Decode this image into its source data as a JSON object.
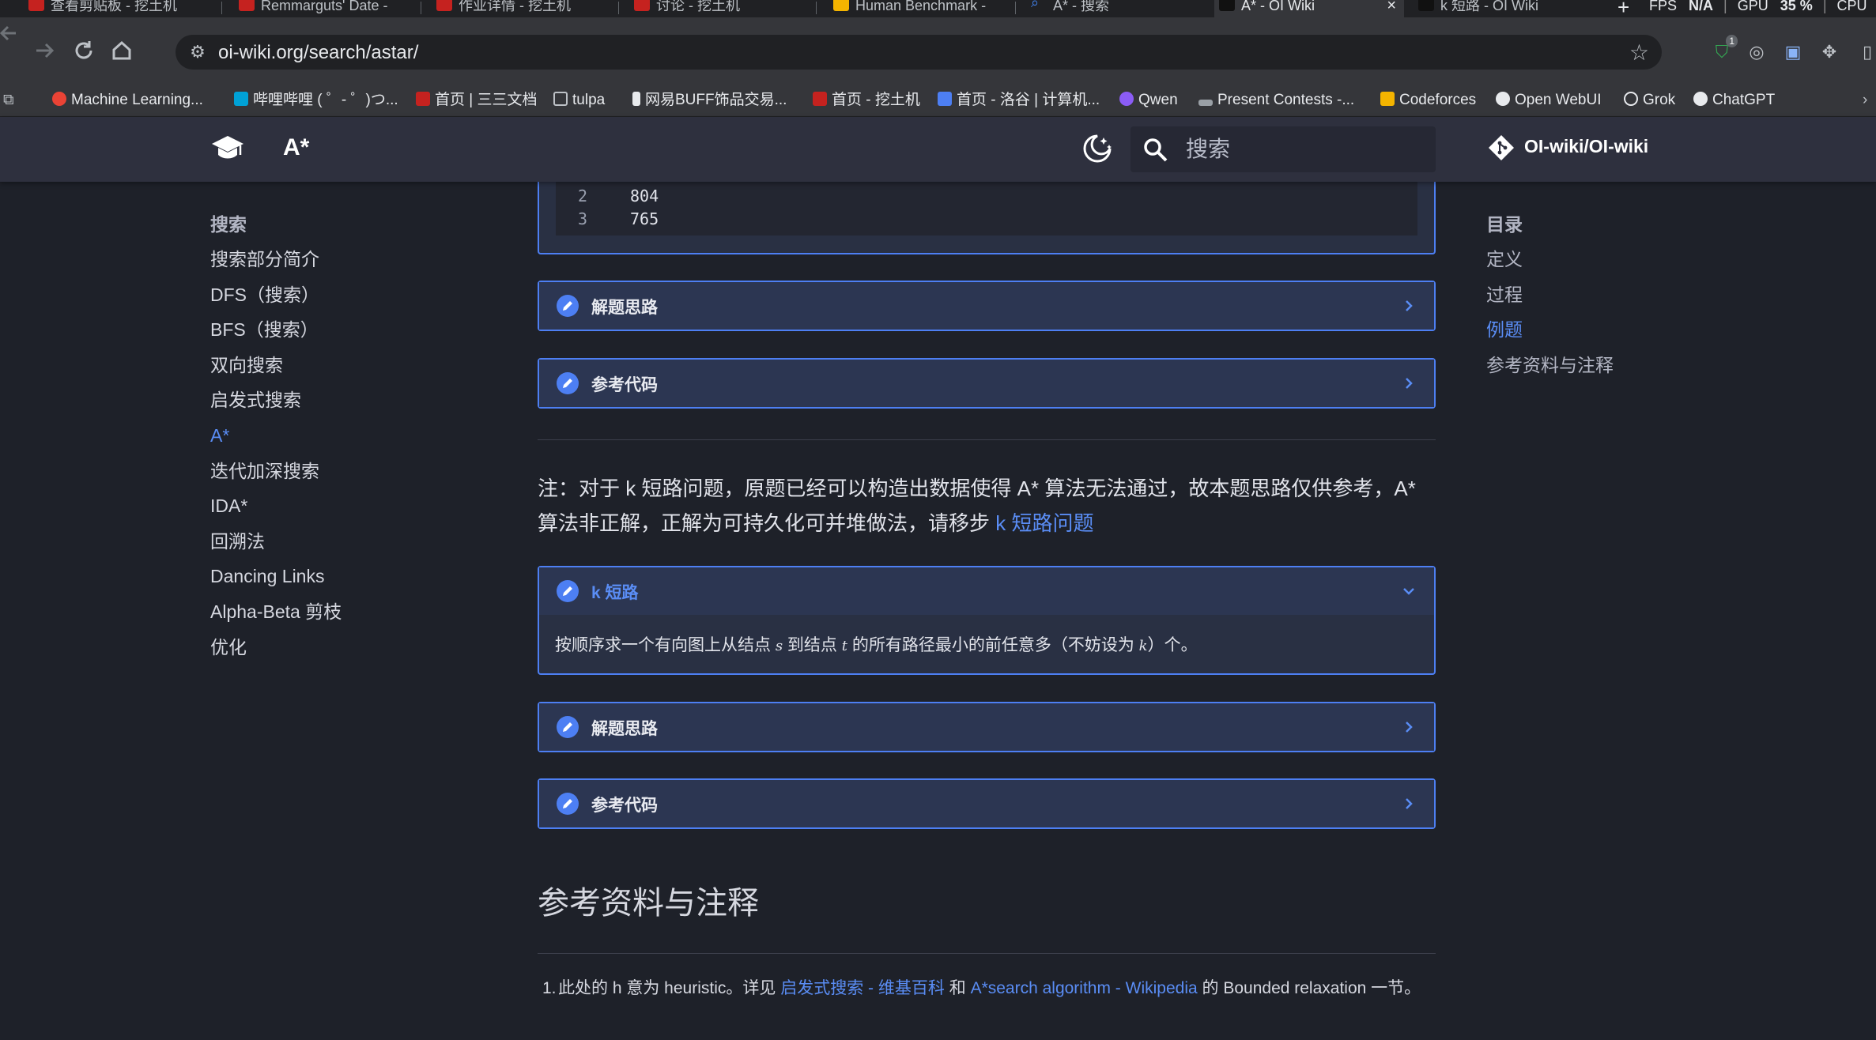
{
  "browser": {
    "tabs": [
      {
        "title": "查看剪贴板 - 挖土机",
        "color": "#c5221f"
      },
      {
        "title": "Remmarguts' Date -",
        "color": "#c5221f"
      },
      {
        "title": "作业详情 - 挖土机",
        "color": "#c5221f"
      },
      {
        "title": "讨论 - 挖土机",
        "color": "#c5221f"
      },
      {
        "title": "Human Benchmark -",
        "color": "#f4b400"
      },
      {
        "title": "A* - 搜索",
        "color": "#4285f4"
      },
      {
        "title": "A* - OI Wiki",
        "color": "#202124"
      },
      {
        "title": "k 短路 - OI Wiki",
        "color": "#202124"
      }
    ],
    "active_tab_close": "×",
    "new_tab": "+",
    "sysinfo": {
      "fps_label": "FPS",
      "fps_value": "N/A",
      "gpu_label": "GPU",
      "gpu_value": "35 %",
      "cpu_label": "CPU"
    },
    "url": "oi-wiki.org/search/astar/",
    "ext_badge": "1",
    "bookmarks": [
      {
        "label": "Machine Learning...",
        "color": "#ea4335"
      },
      {
        "label": "哔哩哔哩 ( ゜- ゜)つ...",
        "color": "#00a1d6"
      },
      {
        "label": "首页 | 三三文档",
        "color": "#c5221f"
      },
      {
        "label": "tulpa",
        "color": "#9aa0a6"
      },
      {
        "label": "网易BUFF饰品交易...",
        "color": "#e8eaed"
      },
      {
        "label": "首页 - 挖土机",
        "color": "#c5221f"
      },
      {
        "label": "首页 - 洛谷 | 计算机...",
        "color": "#4d7ff3"
      },
      {
        "label": "Qwen",
        "color": "#8b5cf6"
      },
      {
        "label": "Present Contests -...",
        "color": "#9aa0a6"
      },
      {
        "label": "Codeforces",
        "color": "#f4b400"
      },
      {
        "label": "Open WebUI",
        "color": "#e8eaed"
      },
      {
        "label": "Grok",
        "color": "#e8eaed"
      },
      {
        "label": "ChatGPT",
        "color": "#e8eaed"
      }
    ]
  },
  "header": {
    "title": "A*",
    "search_placeholder": "搜索",
    "repo": "OI-wiki/OI-wiki"
  },
  "nav": {
    "title": "搜索",
    "items": [
      {
        "label": "搜索部分简介",
        "active": false
      },
      {
        "label": "DFS（搜索）",
        "active": false
      },
      {
        "label": "BFS（搜索）",
        "active": false
      },
      {
        "label": "双向搜索",
        "active": false
      },
      {
        "label": "启发式搜索",
        "active": false
      },
      {
        "label": "A*",
        "active": true
      },
      {
        "label": "迭代加深搜索",
        "active": false
      },
      {
        "label": "IDA*",
        "active": false
      },
      {
        "label": "回溯法",
        "active": false
      },
      {
        "label": "Dancing Links",
        "active": false
      },
      {
        "label": "Alpha-Beta 剪枝",
        "active": false
      },
      {
        "label": "优化",
        "active": false
      }
    ]
  },
  "toc": {
    "title": "目录",
    "items": [
      {
        "label": "定义",
        "active": false
      },
      {
        "label": "过程",
        "active": false
      },
      {
        "label": "例题",
        "active": true
      },
      {
        "label": "参考资料与注释",
        "active": false
      }
    ]
  },
  "content": {
    "code_lines": [
      {
        "n": "2",
        "v": "804"
      },
      {
        "n": "3",
        "v": "765"
      }
    ],
    "details1": "解题思路",
    "details2": "参考代码",
    "note_prefix": "注：对于 k 短路问题，原题已经可以构造出数据使得 A* 算法无法通过，故本题思路仅供参考，A* 算法非正解，正解为可持久化可并堆做法，请移步 ",
    "note_link": "k 短路问题",
    "kpath": {
      "title": "k 短路",
      "body_1": "按顺序求一个有向图上从结点 ",
      "var_s": "s",
      "body_2": " 到结点 ",
      "var_t": "t",
      "body_3": " 的所有路径最小的前任意多（不妨设为 ",
      "var_k": "k",
      "body_4": "）个。"
    },
    "details3": "解题思路",
    "details4": "参考代码",
    "refs_heading": "参考资料与注释",
    "ref1": {
      "num": "1.",
      "t1": "此处的 h 意为 heuristic。详见 ",
      "link1": "启发式搜索 - 维基百科",
      "t2": " 和 ",
      "link2": "A*search algorithm - Wikipedia",
      "t3": " 的 Bounded relaxation 一节。"
    }
  }
}
